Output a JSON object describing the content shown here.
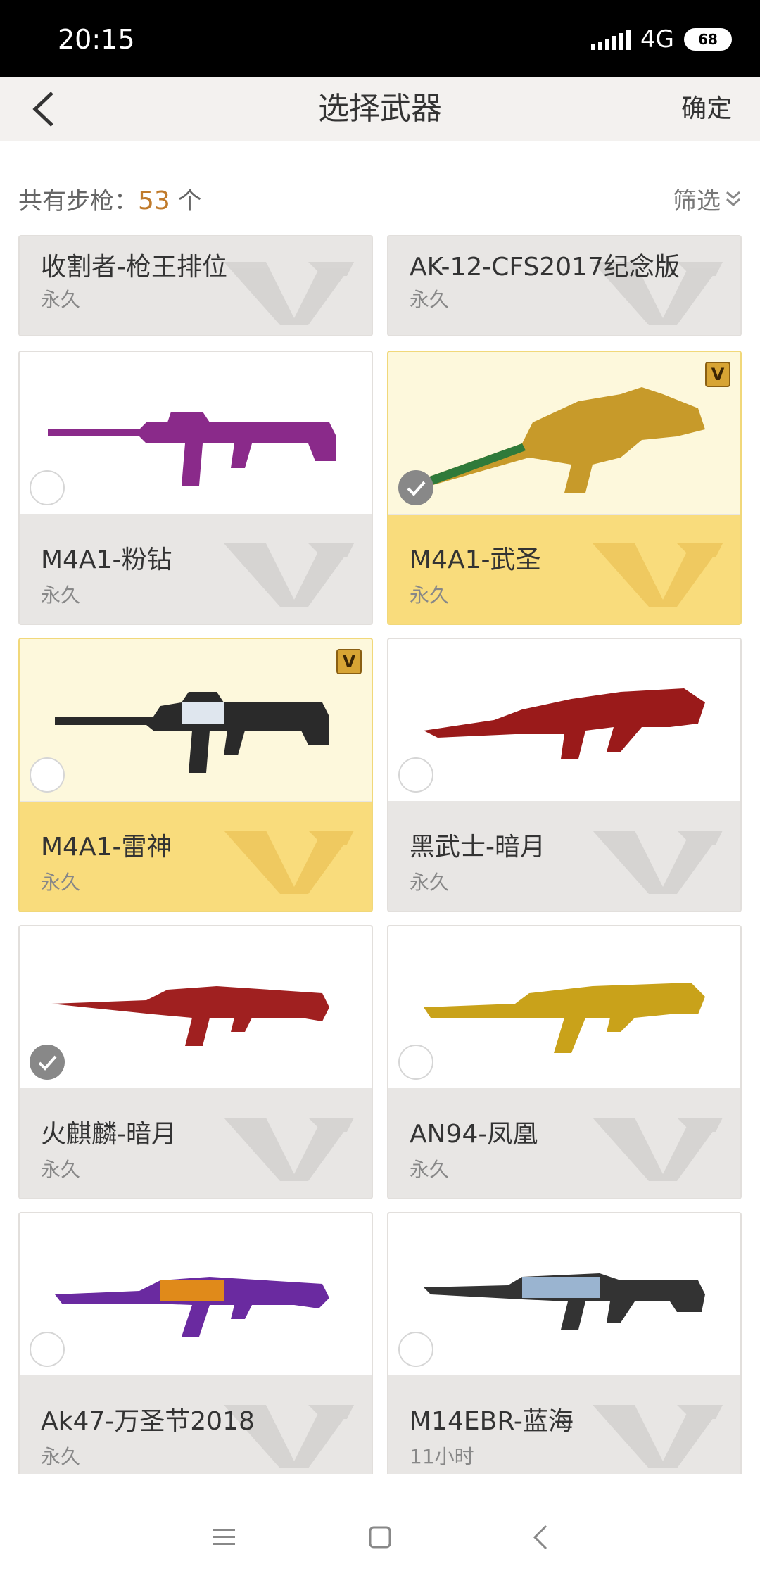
{
  "status": {
    "time": "20:15",
    "network": "4G",
    "battery": "68"
  },
  "nav": {
    "title": "选择武器",
    "confirm": "确定"
  },
  "count": {
    "prefix": "共有步枪：",
    "number": "53",
    "suffix": " 个",
    "filter": "筛选"
  },
  "colors": {
    "accent": "#c07a2a",
    "gold": "#f9dc7c",
    "gold_light": "#fdf8dc",
    "gray": "#e8e6e4"
  },
  "cards": [
    {
      "name": "收割者-枪王排位",
      "duration": "永久",
      "selected": false,
      "gold": false
    },
    {
      "name": "AK-12-CFS2017纪念版",
      "duration": "永久",
      "selected": false,
      "gold": false
    },
    {
      "name": "M4A1-粉钻",
      "duration": "永久",
      "selected": false,
      "gold": false,
      "gun_color": "#8a2a8a"
    },
    {
      "name": "M4A1-武圣",
      "duration": "永久",
      "selected": true,
      "gold": true,
      "vip": "V",
      "gun_color": "#c79a2a"
    },
    {
      "name": "M4A1-雷神",
      "duration": "永久",
      "selected": false,
      "gold": true,
      "vip": "V",
      "gun_color": "#2a2a2a"
    },
    {
      "name": "黑武士-暗月",
      "duration": "永久",
      "selected": false,
      "gold": false,
      "gun_color": "#9a1a1a"
    },
    {
      "name": "火麒麟-暗月",
      "duration": "永久",
      "selected": true,
      "gold": false,
      "gun_color": "#a02020"
    },
    {
      "name": "AN94-凤凰",
      "duration": "永久",
      "selected": false,
      "gold": false,
      "gun_color": "#c9a21a"
    },
    {
      "name": "Ak47-万圣节2018",
      "duration": "永久",
      "selected": false,
      "gold": false,
      "gun_color": "#6a2aa0"
    },
    {
      "name": "M14EBR-蓝海",
      "duration": "11小时",
      "selected": false,
      "gold": false,
      "gun_color": "#333333"
    }
  ]
}
